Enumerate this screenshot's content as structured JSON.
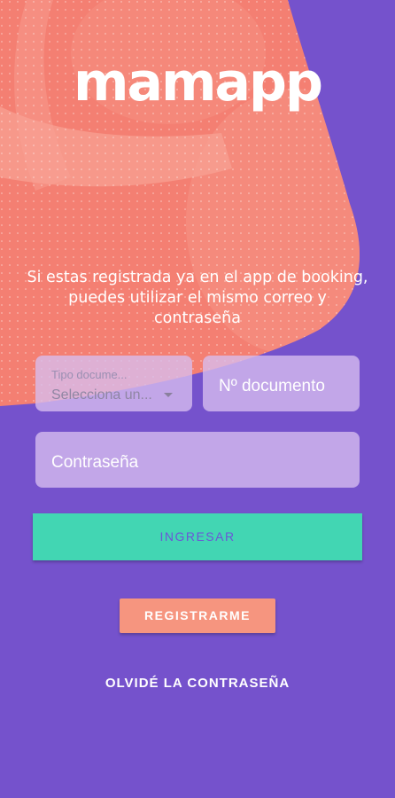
{
  "brand": {
    "logo_text": "mamapp",
    "colors": {
      "background": "#7552cc",
      "hero": "#f47f72",
      "primary_button": "#42d6b3",
      "secondary_button": "#f6957f"
    }
  },
  "intro_text": "Si estas registrada ya en el app de booking, puedes utilizar el mismo correo y contraseña",
  "form": {
    "doc_type": {
      "label": "Tipo docume...",
      "value": "Selecciona un...",
      "icon": "dropdown-caret-icon"
    },
    "doc_number": {
      "placeholder": "Nº documento"
    },
    "password": {
      "placeholder": "Contraseña"
    }
  },
  "actions": {
    "login_label": "INGRESAR",
    "register_label": "REGISTRARME",
    "forgot_label": "OLVIDÉ LA CONTRASEÑA"
  }
}
